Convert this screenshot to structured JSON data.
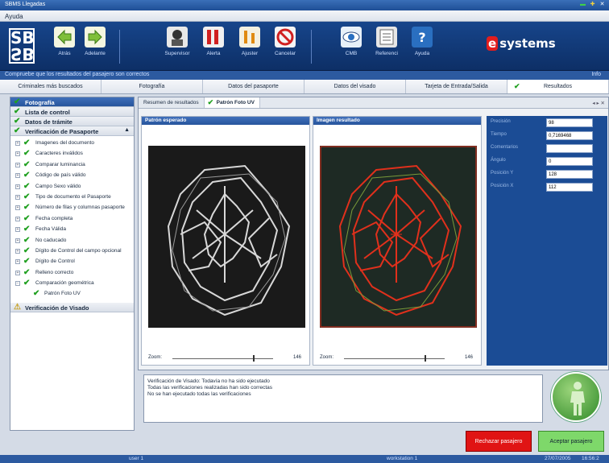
{
  "window": {
    "title": "SBMS Llegadas"
  },
  "menu": {
    "items": [
      "Ayuda"
    ]
  },
  "toolbar": {
    "logo": "SB",
    "buttons": [
      {
        "label": "Atrás",
        "icon": "arrow-left-icon"
      },
      {
        "label": "Adelante",
        "icon": "arrow-right-icon"
      },
      {
        "label": "Supervisor",
        "icon": "supervisor-icon"
      },
      {
        "label": "Alerta",
        "icon": "alert-icon"
      },
      {
        "label": "Ajuster",
        "icon": "adjust-icon"
      },
      {
        "label": "Cancelar",
        "icon": "cancel-icon"
      },
      {
        "label": "CMB",
        "icon": "eye-icon"
      },
      {
        "label": "Referenci",
        "icon": "reference-icon"
      },
      {
        "label": "Ayuda",
        "icon": "help-icon"
      }
    ],
    "brand": "systems"
  },
  "status_line": {
    "text": "Compruebe que los resultados del pasajero son correctos",
    "info": "Info"
  },
  "tabs": [
    "Criminales más buscados",
    "Fotografía",
    "Datos del pasaporte",
    "Datos del visado",
    "Tarjeta de Entrada/Salida",
    "Resultados"
  ],
  "left_panel": {
    "sections": [
      {
        "label": "Fotografía"
      },
      {
        "label": "Lista de control"
      },
      {
        "label": "Datos de trámite"
      },
      {
        "label": "Verificación de Pasaporte"
      }
    ],
    "tree": [
      "Imagenes del documento",
      "Caracteres inválidos",
      "Comparar luminancia",
      "Código de país válido",
      "Campo Sexo válido",
      "Tipo de documento el Pasaporte",
      "Número de filas y columnas pasaporte",
      "Fecha completa",
      "Fecha Válida",
      "No caducado",
      "Dígito de Control del campo opcional",
      "Dígito de Control",
      "Relleno correcto",
      "Comparación geométrica"
    ],
    "tree_sub": "Patrón Foto UV",
    "visa_section": "Verificación de Visado"
  },
  "main": {
    "subtabs": [
      "Resumen de resultados",
      "Patrón Foto UV"
    ],
    "expected": {
      "title": "Patrón esperado",
      "zoom_label": "Zoom:",
      "zoom_value": "146",
      "zoom_level": 0.8
    },
    "result": {
      "title": "Imagen resultado",
      "zoom_label": "Zoom:",
      "zoom_value": "146",
      "zoom_level": 0.8
    },
    "properties": [
      {
        "key": "Precisión",
        "value": "98"
      },
      {
        "key": "Tiempo",
        "value": "0,7169468"
      },
      {
        "key": "Comentarios",
        "value": ""
      },
      {
        "key": "Ángulo",
        "value": "0"
      },
      {
        "key": "Posición Y",
        "value": "128"
      },
      {
        "key": "Posición X",
        "value": "112"
      }
    ]
  },
  "log": [
    "Verificación de Visado: Todavía no ha sido ejecutado",
    "Todas las verificaciones realizadas han sido correctas",
    "No se han ejecutado todas las verificaciones"
  ],
  "actions": {
    "reject": "Rechazar pasajero",
    "accept": "Aceptar pasajero"
  },
  "status_bar": {
    "user": "user 1",
    "station": "workstation 1",
    "date": "27/07/2005",
    "time": "16:56:2"
  },
  "colors": {
    "accent": "#1b4c95",
    "ok": "#20a020",
    "reject": "#e01414",
    "accept": "#7ed86a"
  }
}
